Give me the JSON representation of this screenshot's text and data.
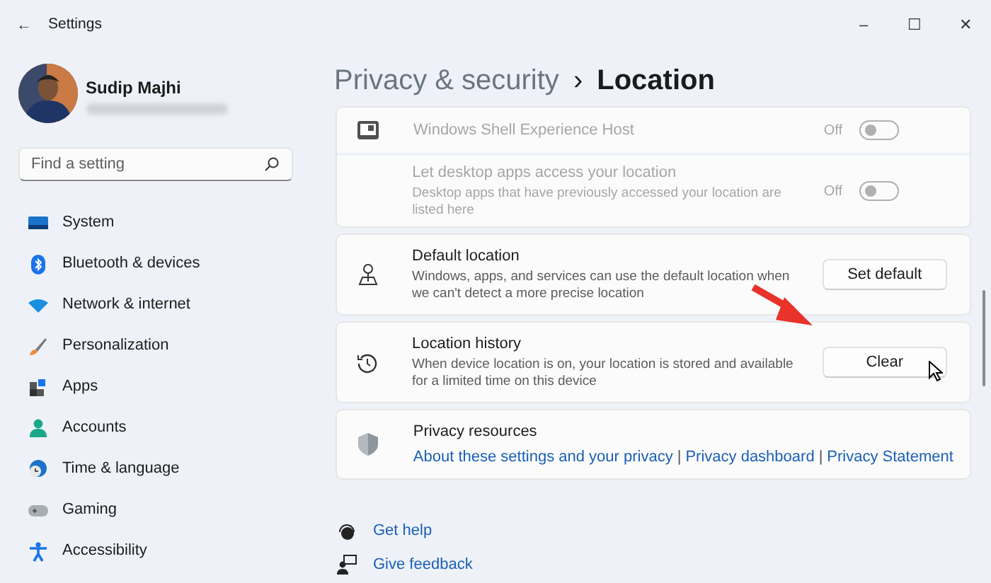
{
  "window": {
    "title": "Settings",
    "back": "←",
    "controls": [
      "–",
      "☐",
      "✕"
    ]
  },
  "user": {
    "name": "Sudip Majhi"
  },
  "search": {
    "placeholder": "Find a setting"
  },
  "nav": [
    {
      "label": "System",
      "selected": false
    },
    {
      "label": "Bluetooth & devices",
      "selected": false
    },
    {
      "label": "Network & internet",
      "selected": false
    },
    {
      "label": "Personalization",
      "selected": false
    },
    {
      "label": "Apps",
      "selected": false
    },
    {
      "label": "Accounts",
      "selected": false
    },
    {
      "label": "Time & language",
      "selected": false
    },
    {
      "label": "Gaming",
      "selected": false
    },
    {
      "label": "Accessibility",
      "selected": false
    }
  ],
  "breadcrumb": {
    "parent": "Privacy & security",
    "separator": "›",
    "current": "Location"
  },
  "cards": [
    {
      "rows": [
        {
          "kind": "toggle",
          "title": "Windows Shell Experience Host",
          "disabled": true,
          "state": "Off",
          "on": false
        },
        {
          "kind": "toggle",
          "title": "Let desktop apps access your location",
          "description": "Desktop apps that have previously accessed your location are listed here",
          "disabled": true,
          "state": "Off",
          "on": false
        }
      ]
    },
    {
      "rows": [
        {
          "kind": "button",
          "title": "Default location",
          "description": "Windows, apps, and services can use the default location when we can't detect a more precise location",
          "button": "Set default"
        }
      ]
    },
    {
      "rows": [
        {
          "kind": "button",
          "title": "Location history",
          "description": "When device location is on, your location is stored and available for a limited time on this device",
          "button": "Clear"
        }
      ]
    },
    {
      "rows": [
        {
          "kind": "links",
          "title": "Privacy resources",
          "links": [
            "About these settings and your privacy",
            "Privacy dashboard",
            "Privacy Statement"
          ],
          "link_separator": "|"
        }
      ]
    }
  ],
  "footer": [
    {
      "label": "Get help"
    },
    {
      "label": "Give feedback"
    }
  ]
}
